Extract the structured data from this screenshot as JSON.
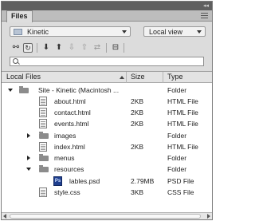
{
  "panel": {
    "tab_label": "Files"
  },
  "toolbar": {
    "site_name": "Kinetic",
    "view_mode": "Local view",
    "icons": [
      "connect-icon",
      "refresh-icon",
      "get-icon",
      "put-icon",
      "check-out-icon",
      "check-in-icon",
      "sync-icon",
      "expand-icon"
    ]
  },
  "search": {
    "placeholder": ""
  },
  "columns": {
    "name": "Local Files",
    "size": "Size",
    "type": "Type"
  },
  "rows": [
    {
      "name": "Site - Kinetic (Macintosh ...",
      "size": "",
      "type": "Folder",
      "kind": "site",
      "expander": "open"
    },
    {
      "name": "about.html",
      "size": "2KB",
      "type": "HTML File",
      "kind": "file",
      "expander": ""
    },
    {
      "name": "contact.html",
      "size": "2KB",
      "type": "HTML File",
      "kind": "file",
      "expander": ""
    },
    {
      "name": "events.html",
      "size": "2KB",
      "type": "HTML File",
      "kind": "file",
      "expander": ""
    },
    {
      "name": "images",
      "size": "",
      "type": "Folder",
      "kind": "folder",
      "expander": "closed"
    },
    {
      "name": "index.html",
      "size": "2KB",
      "type": "HTML File",
      "kind": "file",
      "expander": ""
    },
    {
      "name": "menus",
      "size": "",
      "type": "Folder",
      "kind": "folder",
      "expander": "closed"
    },
    {
      "name": "resources",
      "size": "",
      "type": "Folder",
      "kind": "folder",
      "expander": "open"
    },
    {
      "name": "lables.psd",
      "size": "2.79MB",
      "type": "PSD File",
      "kind": "psd",
      "expander": ""
    },
    {
      "name": "style.css",
      "size": "3KB",
      "type": "CSS File",
      "kind": "file",
      "expander": ""
    }
  ]
}
